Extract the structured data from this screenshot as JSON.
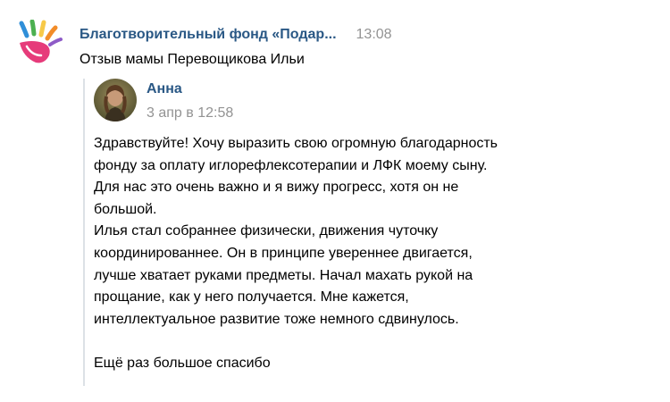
{
  "post": {
    "author": "Благотворительный фонд «Подар...",
    "time": "13:08",
    "text": "Отзыв мамы Перевощикова Ильи"
  },
  "logo": {
    "icon": "colorful-hand-logo",
    "colors": [
      "#e63b7a",
      "#f28c28",
      "#f7c948",
      "#4cb050",
      "#2f8fd8",
      "#8e5bc7"
    ]
  },
  "repost": {
    "author": "Анна",
    "date": "3 апр в 12:58",
    "avatar_icon": "user-photo-avatar",
    "lines": [
      "Здравствуйте! Хочу выразить свою огромную благодарность",
      "фонду за оплату иглорефлексотерапии и ЛФК моему сыну.",
      "Для нас это очень важно и я вижу прогресс, хотя он не",
      "большой.",
      "Илья стал собраннее физически, движения чуточку",
      "координированнее. Он в принципе увереннее двигается,",
      "лучше хватает руками предметы. Начал махать рукой на",
      "прощание, как у него получается. Мне кажется,",
      "интеллектуальное развитие тоже немного сдвинулось.",
      "",
      "Ещё раз большое спасибо"
    ]
  },
  "colors": {
    "link": "#2a5885",
    "meta": "#939393",
    "bar": "#dce1e6"
  }
}
